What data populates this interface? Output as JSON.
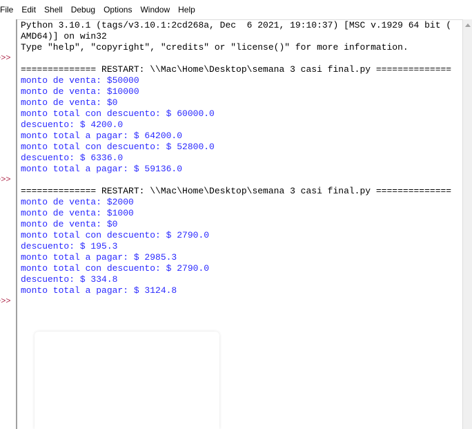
{
  "menu": [
    "File",
    "Edit",
    "Shell",
    "Debug",
    "Options",
    "Window",
    "Help"
  ],
  "prompt": ">>>",
  "banner": [
    "Python 3.10.1 (tags/v3.10.1:2cd268a, Dec  6 2021, 19:10:37) [MSC v.1929 64 bit (",
    "AMD64)] on win32",
    "Type \"help\", \"copyright\", \"credits\" or \"license()\" for more information."
  ],
  "runs": [
    {
      "restart": "============== RESTART: \\\\Mac\\Home\\Desktop\\semana 3 casi final.py ==============",
      "output": [
        "monto de venta: $50000",
        "monto de venta: $10000",
        "monto de venta: $0",
        "monto total con descuento: $ 60000.0",
        "descuento: $ 4200.0",
        "monto total a pagar: $ 64200.0",
        "monto total con descuento: $ 52800.0",
        "descuento: $ 6336.0",
        "monto total a pagar: $ 59136.0"
      ]
    },
    {
      "restart": "============== RESTART: \\\\Mac\\Home\\Desktop\\semana 3 casi final.py ==============",
      "output": [
        "monto de venta: $2000",
        "monto de venta: $1000",
        "monto de venta: $0",
        "monto total con descuento: $ 2790.0",
        "descuento: $ 195.3",
        "monto total a pagar: $ 2985.3",
        "monto total con descuento: $ 2790.0",
        "descuento: $ 334.8",
        "monto total a pagar: $ 3124.8"
      ]
    }
  ]
}
